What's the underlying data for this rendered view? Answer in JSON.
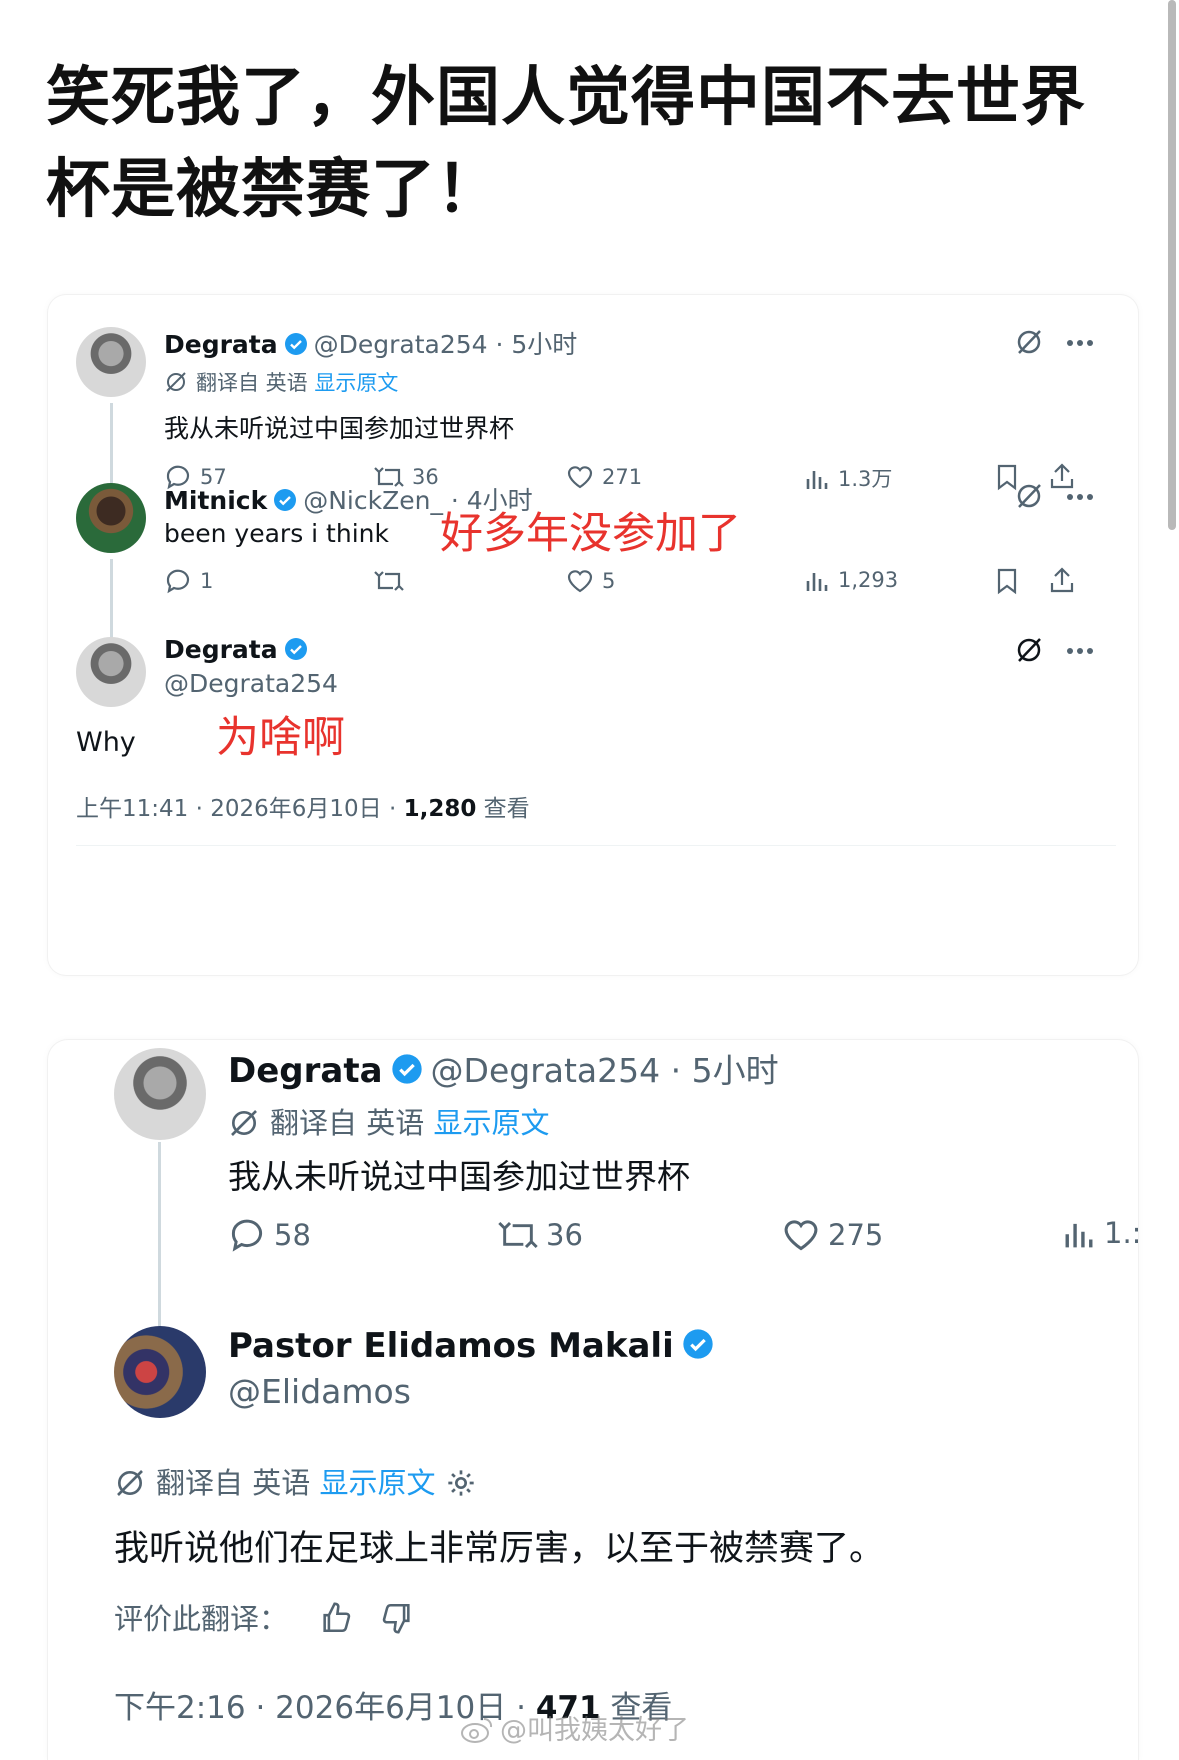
{
  "headline": "笑死我了，外国人觉得中国不去世界杯是被禁赛了！",
  "card1": {
    "tweet1": {
      "name": "Degrata",
      "handle_time": "@Degrata254 · 5小时",
      "translated_from": "翻译自 英语",
      "show_original": "显示原文",
      "text": "我从未听说过中国参加过世界杯",
      "replies": "57",
      "reposts": "36",
      "likes": "271",
      "views": "1.3万"
    },
    "tweet2": {
      "name": "Mitnick",
      "handle_time": "@NickZen_ · 4小时",
      "text": "been years i think",
      "replies": "1",
      "reposts": "",
      "likes": "5",
      "views": "1,293",
      "annotation": "好多年没参加了"
    },
    "tweet3": {
      "name": "Degrata",
      "handle": "@Degrata254",
      "text": "Why",
      "annotation": "为啥啊",
      "meta_time": "上午11:41 · 2026年6月10日 · ",
      "meta_views": "1,280",
      "meta_views_label": " 查看"
    }
  },
  "card2": {
    "tweet1": {
      "name": "Degrata",
      "handle_time": "@Degrata254 · 5小时",
      "translated_from": "翻译自 英语",
      "show_original": "显示原文",
      "text": "我从未听说过中国参加过世界杯",
      "replies": "58",
      "reposts": "36",
      "likes": "275",
      "views": "1.:"
    },
    "tweet2": {
      "name": "Pastor Elidamos Makali",
      "handle": "@Elidamos",
      "translated_from": "翻译自 英语",
      "show_original": "显示原文",
      "text": "我听说他们在足球上非常厉害，以至于被禁赛了。",
      "rate_label": "评价此翻译：",
      "meta_time": "下午2:16 · 2026年6月10日 · ",
      "meta_views": "471",
      "meta_views_label": " 查看"
    }
  },
  "watermark": "@叫我姨太好了",
  "colors": {
    "verified": "#1d9bf0",
    "link": "#1d9bf0",
    "annotation": "#e8332d",
    "muted": "#536471"
  }
}
